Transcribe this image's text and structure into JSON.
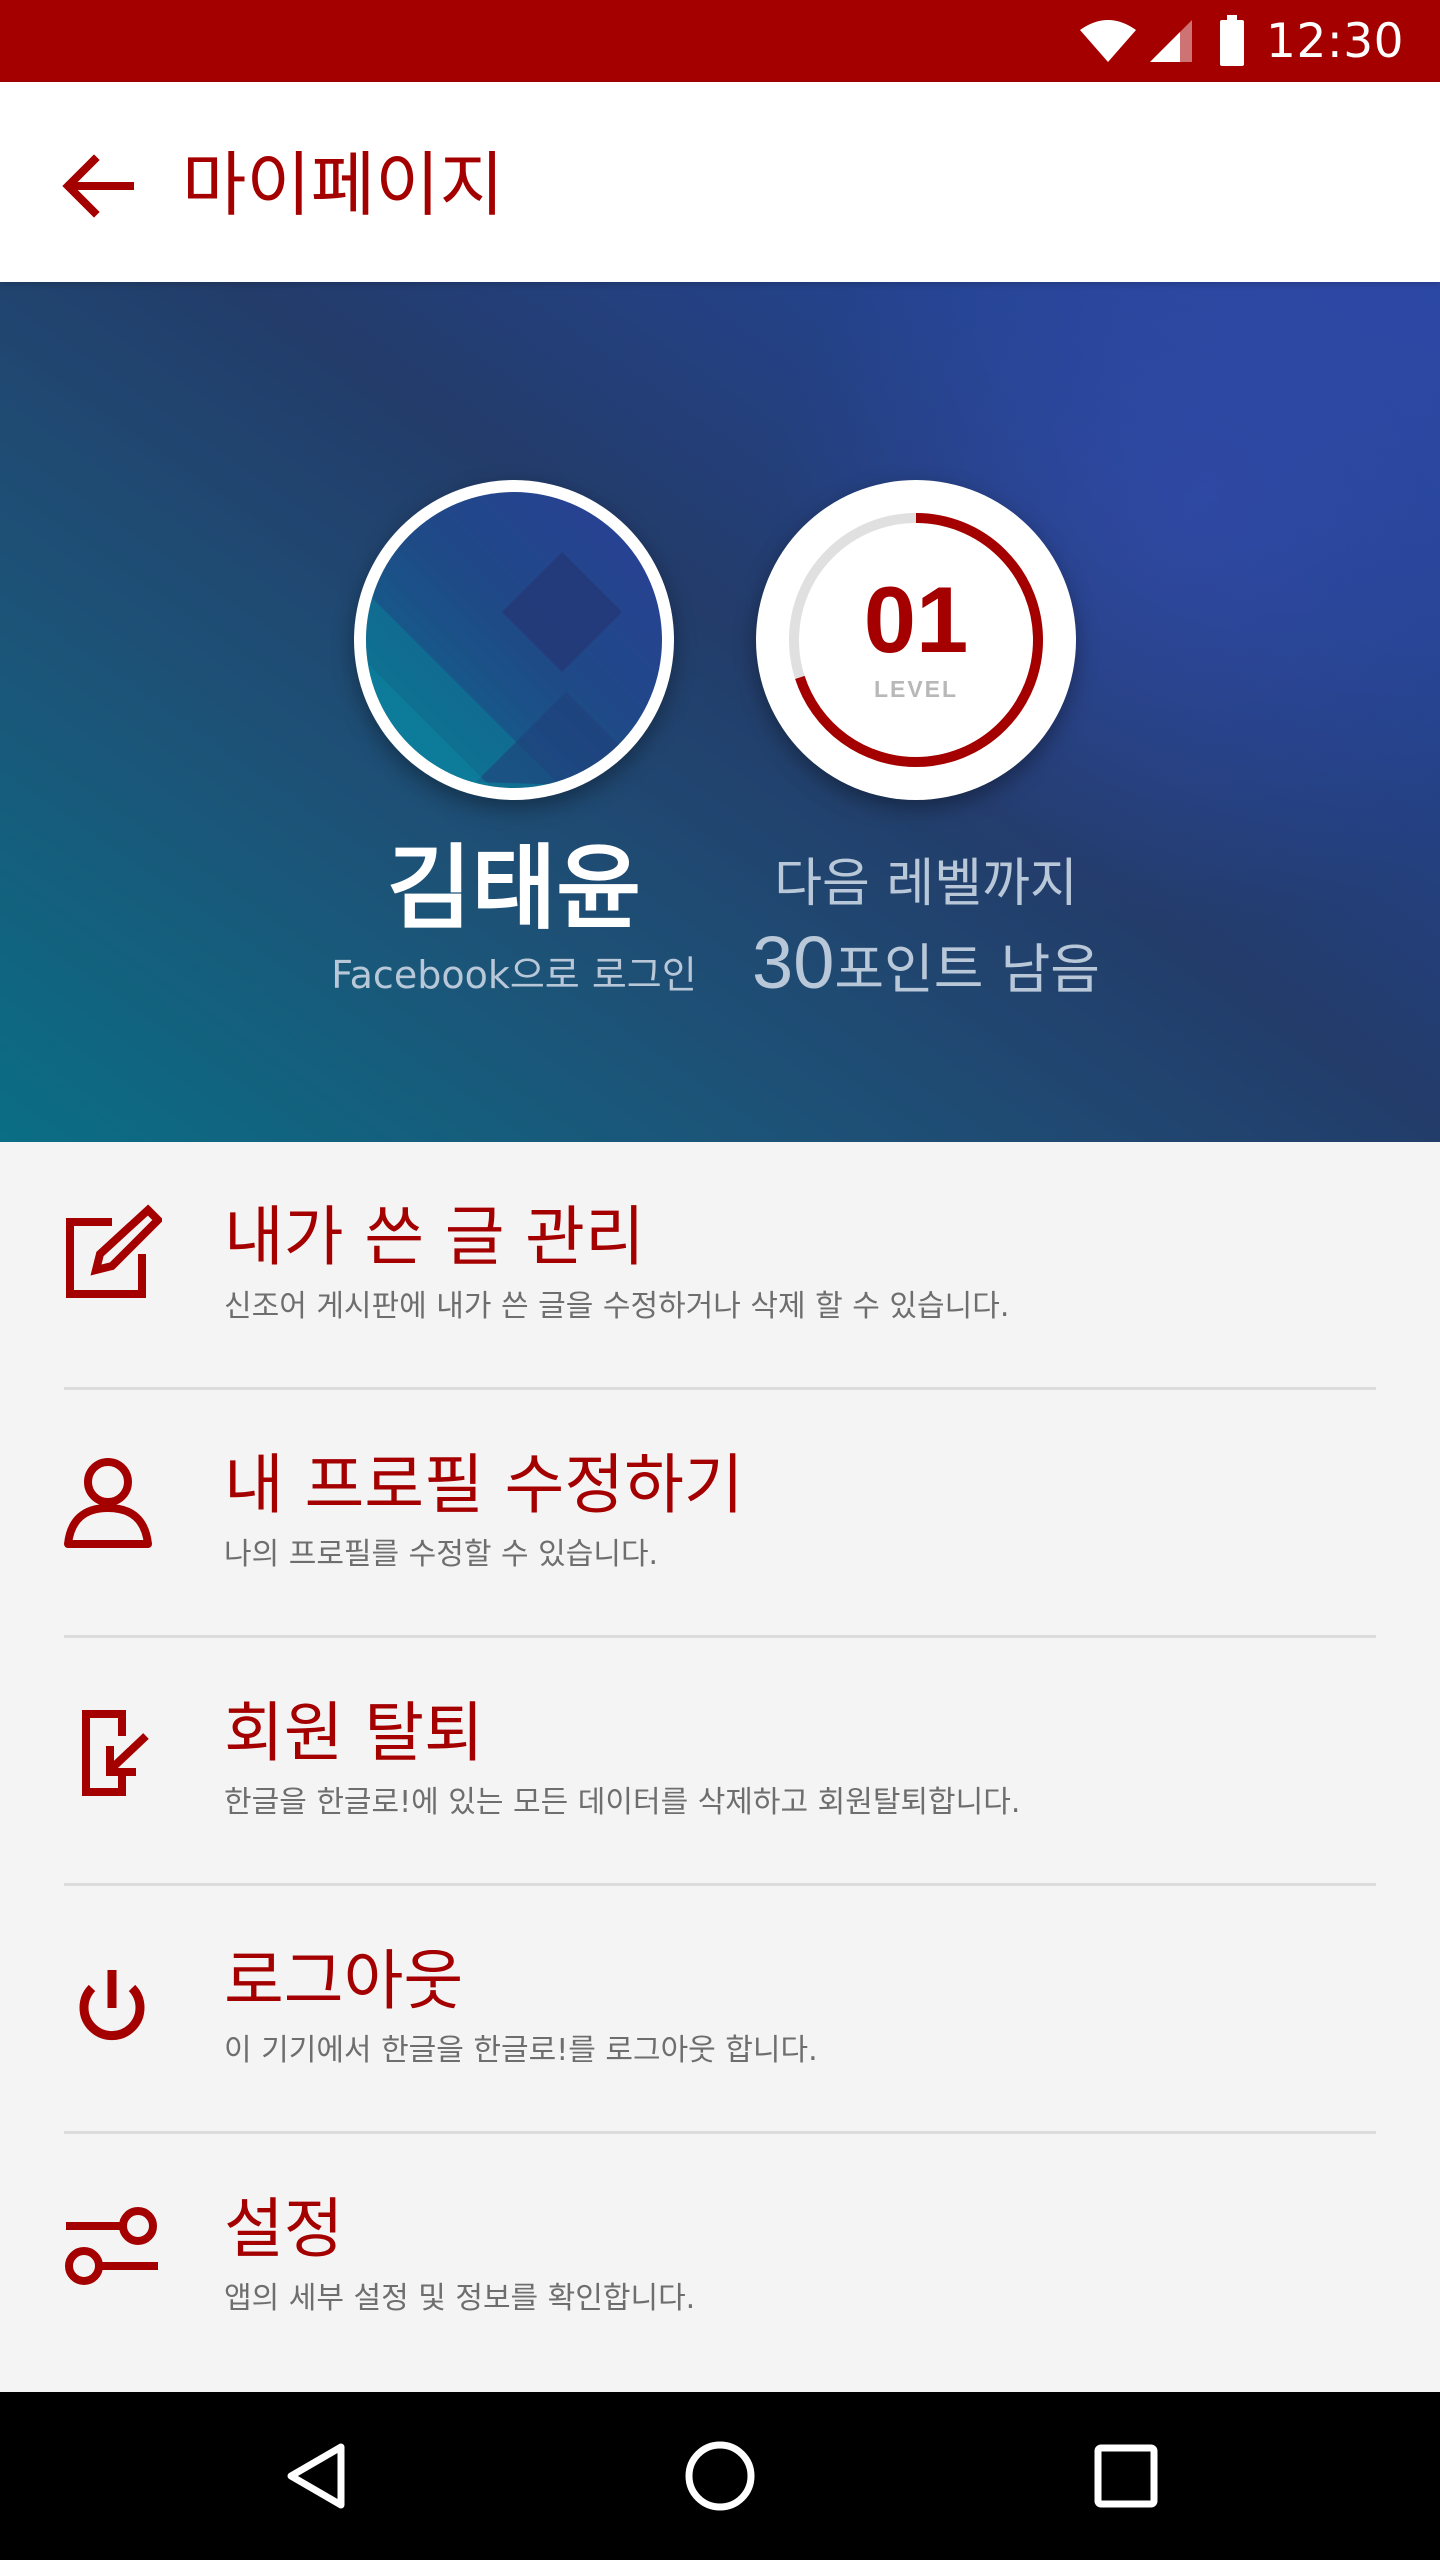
{
  "status_bar": {
    "time": "12:30",
    "icons": [
      "wifi-icon",
      "cell-signal-icon",
      "battery-icon"
    ]
  },
  "app_bar": {
    "back_icon": "arrow-back-icon",
    "title": "마이페이지"
  },
  "profile": {
    "user_name": "김태윤",
    "login_method": "Facebook으로 로그인",
    "level_number": "01",
    "level_label": "LEVEL",
    "level_progress": 0.7,
    "next_level_text": "다음 레벨까지",
    "points_value": "30",
    "points_suffix": "포인트 남음"
  },
  "menu": {
    "items": [
      {
        "icon": "edit-icon",
        "title": "내가 쓴 글 관리",
        "description": "신조어 게시판에 내가 쓴 글을 수정하거나 삭제 할 수 있습니다."
      },
      {
        "icon": "user-icon",
        "title": "내 프로필 수정하기",
        "description": "나의 프로필를 수정할 수 있습니다."
      },
      {
        "icon": "exit-icon",
        "title": "회원 탈퇴",
        "description": "한글을 한글로!에 있는 모든 데이터를 삭제하고 회원탈퇴합니다."
      },
      {
        "icon": "power-icon",
        "title": "로그아웃",
        "description": "이 기기에서 한글을 한글로!를 로그아웃 합니다."
      },
      {
        "icon": "settings-icon",
        "title": "설정",
        "description": "앱의 세부 설정 및 정보를 확인합니다."
      }
    ]
  },
  "nav_bar": {
    "buttons": [
      "back-triangle-icon",
      "home-circle-icon",
      "recents-square-icon"
    ]
  },
  "colors": {
    "accent": "#a50000",
    "header_gradient_start": "#0a6e84",
    "header_gradient_end": "#2a47a3",
    "menu_background": "#f4f4f4",
    "description_text": "#6e6e6e"
  }
}
